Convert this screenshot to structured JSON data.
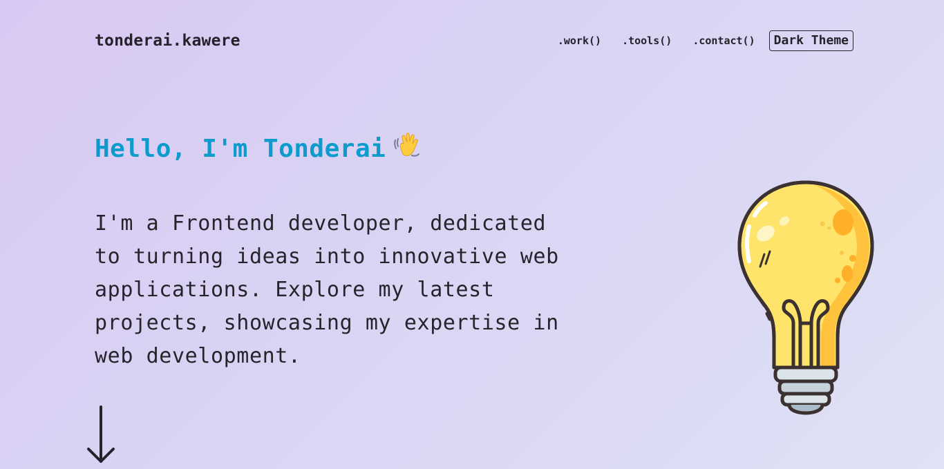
{
  "header": {
    "logo": "tonderai.kawere",
    "nav": [
      {
        "label": ".work()"
      },
      {
        "label": ".tools()"
      },
      {
        "label": ".contact()"
      }
    ],
    "theme_button": "Dark Theme"
  },
  "hero": {
    "title": "Hello, I'm Tonderai",
    "wave_icon": "waving-hand-icon",
    "description": "I'm a Frontend developer, dedicated to turning ideas into innovative web applications. Explore my latest projects, showcasing my expertise in web development."
  },
  "icons": {
    "scroll": "arrow-down-icon",
    "illustration": "lightbulb-icon"
  },
  "colors": {
    "title": "#0c9bcc",
    "text": "#27232c",
    "bulb": "#ffd84d"
  }
}
